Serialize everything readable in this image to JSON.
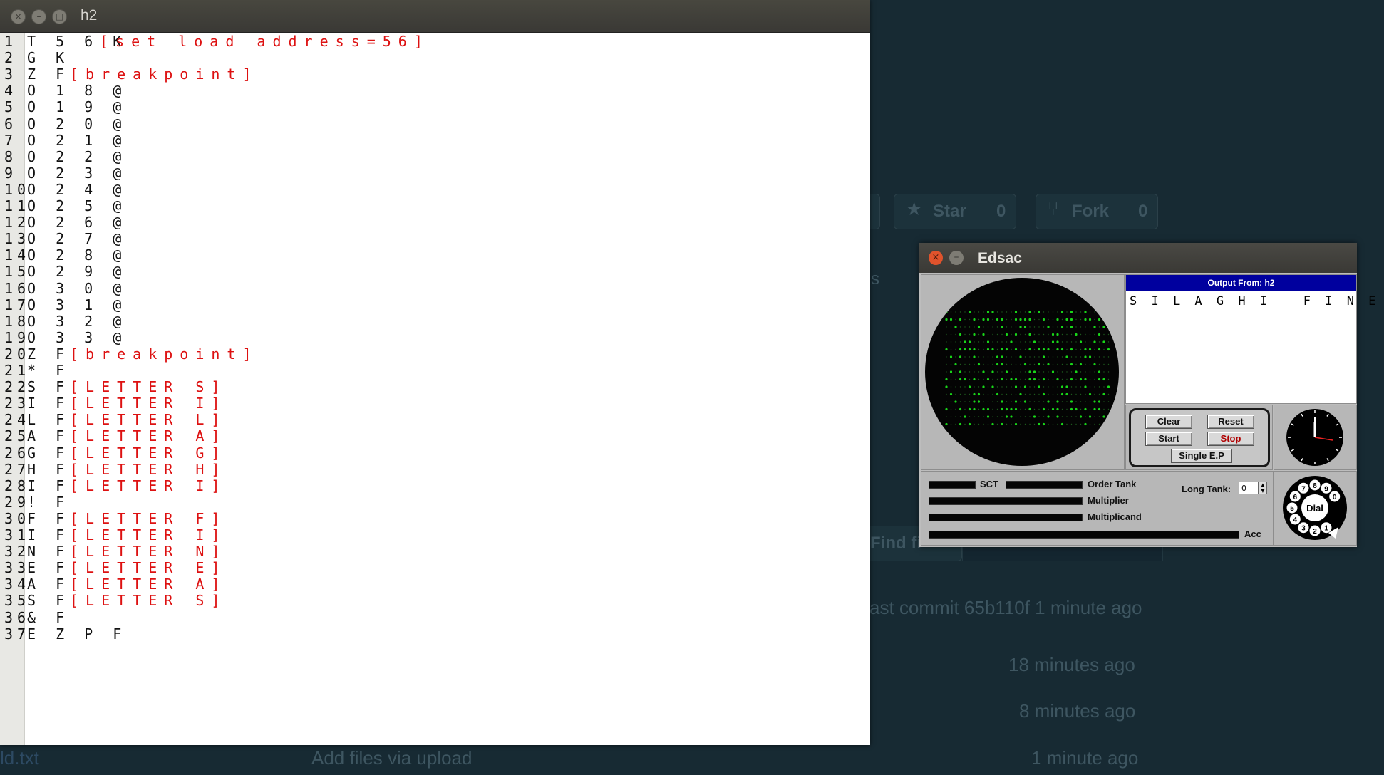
{
  "background_page": {
    "star_label": "Star",
    "star_count": "0",
    "fork_label": "Fork",
    "fork_count": "0",
    "find_file_label": "Find fi",
    "partial_s": "s",
    "last_commit": "ast commit 65b110f 1 minute ago",
    "time_1": "18 minutes ago",
    "time_2": "8 minutes ago",
    "time_3": "1 minute ago",
    "file_name": "ld.txt",
    "commit_message": "Add files via upload"
  },
  "h2_window": {
    "title": "h2",
    "lines": [
      {
        "n": "1",
        "code": "T 5 6 K",
        "comment": "[set load address=56]"
      },
      {
        "n": "2",
        "code": "G K",
        "comment": ""
      },
      {
        "n": "3",
        "code": "Z F",
        "comment": "[breakpoint]"
      },
      {
        "n": "4",
        "code": "O 1 8 @",
        "comment": ""
      },
      {
        "n": "5",
        "code": "O 1 9 @",
        "comment": ""
      },
      {
        "n": "6",
        "code": "O 2 0 @",
        "comment": ""
      },
      {
        "n": "7",
        "code": "O 2 1 @",
        "comment": ""
      },
      {
        "n": "8",
        "code": "O 2 2 @",
        "comment": ""
      },
      {
        "n": "9",
        "code": "O 2 3 @",
        "comment": ""
      },
      {
        "n": "10",
        "code": "O 2 4 @",
        "comment": ""
      },
      {
        "n": "11",
        "code": "O 2 5 @",
        "comment": ""
      },
      {
        "n": "12",
        "code": "O 2 6 @",
        "comment": ""
      },
      {
        "n": "13",
        "code": "O 2 7 @",
        "comment": ""
      },
      {
        "n": "14",
        "code": "O 2 8 @",
        "comment": ""
      },
      {
        "n": "15",
        "code": "O 2 9 @",
        "comment": ""
      },
      {
        "n": "16",
        "code": "O 3 0 @",
        "comment": ""
      },
      {
        "n": "17",
        "code": "O 3 1 @",
        "comment": ""
      },
      {
        "n": "18",
        "code": "O 3 2 @",
        "comment": ""
      },
      {
        "n": "19",
        "code": "O 3 3 @",
        "comment": ""
      },
      {
        "n": "20",
        "code": "Z F",
        "comment": "[breakpoint]"
      },
      {
        "n": "21",
        "code": "* F",
        "comment": ""
      },
      {
        "n": "22",
        "code": "S F",
        "comment": "[LETTER S]"
      },
      {
        "n": "23",
        "code": "I F",
        "comment": "[LETTER I]"
      },
      {
        "n": "24",
        "code": "L F",
        "comment": "[LETTER L]"
      },
      {
        "n": "25",
        "code": "A F",
        "comment": "[LETTER A]"
      },
      {
        "n": "26",
        "code": "G F",
        "comment": "[LETTER G]"
      },
      {
        "n": "27",
        "code": "H F",
        "comment": "[LETTER H]"
      },
      {
        "n": "28",
        "code": "I F",
        "comment": "[LETTER I]"
      },
      {
        "n": "29",
        "code": "! F",
        "comment": ""
      },
      {
        "n": "30",
        "code": "F F",
        "comment": "[LETTER F]"
      },
      {
        "n": "31",
        "code": "I F",
        "comment": "[LETTER I]"
      },
      {
        "n": "32",
        "code": "N F",
        "comment": "[LETTER N]"
      },
      {
        "n": "33",
        "code": "E F",
        "comment": "[LETTER E]"
      },
      {
        "n": "34",
        "code": "A F",
        "comment": "[LETTER A]"
      },
      {
        "n": "35",
        "code": "S F",
        "comment": "[LETTER S]"
      },
      {
        "n": "36",
        "code": "& F",
        "comment": ""
      },
      {
        "n": "37",
        "code": "E Z P F",
        "comment": ""
      }
    ]
  },
  "edsac_window": {
    "title": "Edsac",
    "output_header": "Output From: h2",
    "output_text": "S I L A G H I   F I N E A S",
    "buttons": {
      "clear": "Clear",
      "reset": "Reset",
      "start": "Start",
      "stop": "Stop",
      "single_ep": "Single E.P"
    },
    "tank_labels": {
      "sct": "SCT",
      "order_tank": "Order Tank",
      "multiplier": "Multiplier",
      "multiplicand": "Multiplicand",
      "acc": "Acc",
      "long_tank": "Long Tank:"
    },
    "long_tank_value": "0",
    "dial_label": "Dial",
    "dial_digits": [
      "1",
      "2",
      "3",
      "4",
      "5",
      "6",
      "7",
      "8",
      "9",
      "0"
    ]
  },
  "colors": {
    "comment_red": "#dd1111",
    "output_header_blue": "#00009e",
    "scope_dot_green": "#19d619",
    "desktop_bg": "#172a33"
  }
}
